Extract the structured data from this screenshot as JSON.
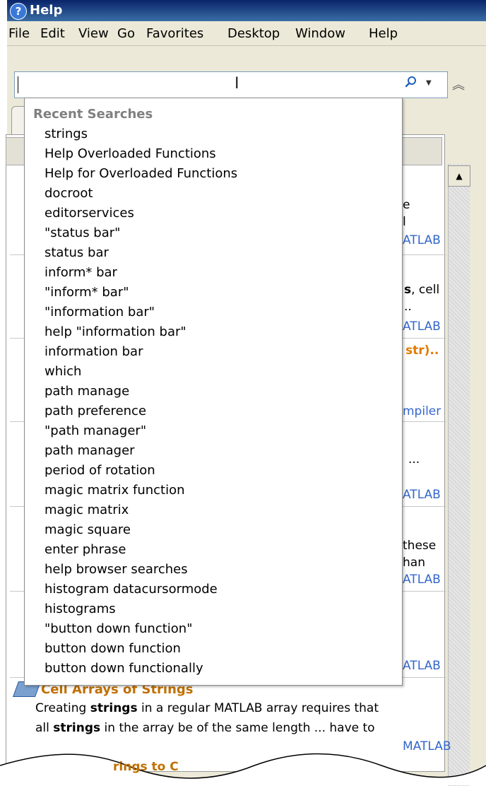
{
  "window": {
    "title": "Help"
  },
  "menu": [
    "File",
    "Edit",
    "View",
    "Go",
    "Favorites",
    "Desktop",
    "Window",
    "Help"
  ],
  "search": {
    "value": "",
    "placeholder": ""
  },
  "icons": {
    "search": "magnifier-icon",
    "dropdown": "chevron-down-icon",
    "collapse": "double-chevron-up-icon",
    "help": "help-question-icon"
  },
  "dropdown": {
    "heading": "Recent Searches",
    "items": [
      "strings",
      "Help Overloaded Functions",
      "Help for Overloaded Functions",
      "docroot",
      "editorservices",
      "\"status bar\"",
      "status bar",
      "inform* bar",
      "\"inform* bar\"",
      "\"information bar\"",
      "help \"information bar\"",
      "information bar",
      "which",
      "path manage",
      "path preference",
      "\"path manager\"",
      "path manager",
      "period of rotation",
      "magic matrix function",
      "magic matrix",
      "magic square",
      "enter phrase",
      "help browser searches",
      "histogram datacursormode",
      "histograms",
      "\"button down function\"",
      "button down function",
      "button down functionally"
    ]
  },
  "background_fragments": {
    "frag1": "e",
    "frag2": "l",
    "frag3": "ATLAB",
    "frag4a": "s",
    "frag4b": ", cell",
    "frag5": "..",
    "frag6": "ATLAB",
    "frag7": "str)..",
    "frag8": "mpiler",
    "frag9": "...",
    "frag10": "ATLAB",
    "frag11": "these",
    "frag12": "han",
    "frag13": "ATLAB",
    "frag14": "ATLAB"
  },
  "result_card": {
    "title": "Cell Arrays of Strings",
    "line1_pre": "Creating ",
    "line1_bold": "strings",
    "line1_post": " in a regular MATLAB array requires that",
    "line2_pre": "all ",
    "line2_bold": "strings",
    "line2_post": " in the array be of the same length ... have to",
    "source": "MATLAB",
    "next_title": "rings to C"
  },
  "colors": {
    "titlebar": "#0a246a",
    "link": "#3366cc",
    "highlight": "#e07b00"
  }
}
